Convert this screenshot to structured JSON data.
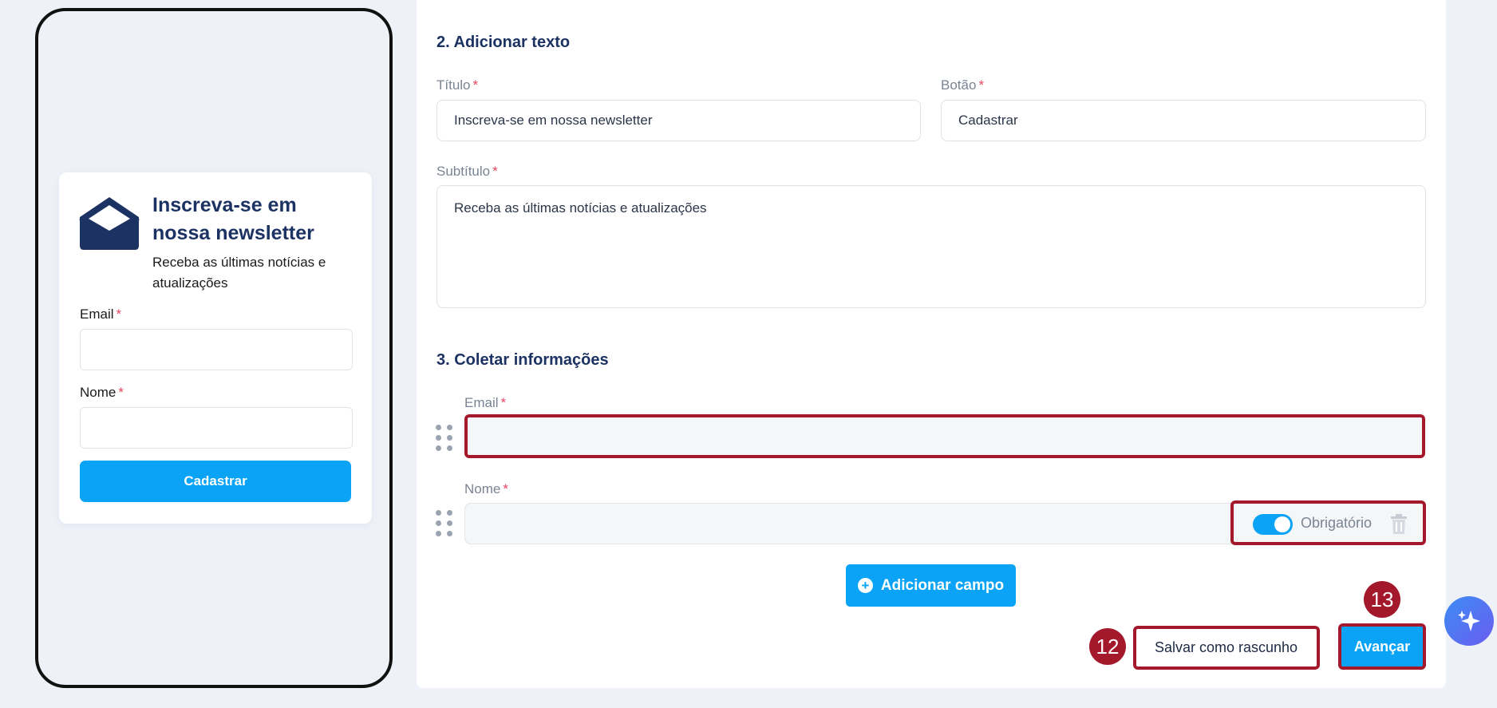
{
  "preview": {
    "title": "Inscreva-se em nossa newsletter",
    "subtitle": "Receba as últimas notícias e atualizações",
    "fields": [
      {
        "label": "Email",
        "required_mark": "*"
      },
      {
        "label": "Nome",
        "required_mark": "*"
      }
    ],
    "button_label": "Cadastrar",
    "icon": "envelope-open-icon"
  },
  "section_text": {
    "heading": "2. Adicionar texto",
    "title_label": "Título",
    "title_value": "Inscreva-se em nossa newsletter",
    "button_label": "Botão",
    "button_value": "Cadastrar",
    "subtitle_label": "Subtítulo",
    "subtitle_value": "Receba as últimas notícias e atualizações",
    "required_mark": "*"
  },
  "section_collect": {
    "heading": "3. Coletar informações",
    "fields": [
      {
        "label": "Email",
        "required_mark": "*"
      },
      {
        "label": "Nome",
        "required_mark": "*",
        "toggle_label": "Obrigatório",
        "toggle_on": true
      }
    ],
    "add_field_label": "Adicionar campo"
  },
  "footer": {
    "draft_label": "Salvar como rascunho",
    "next_label": "Avançar"
  },
  "badges": {
    "draft": "12",
    "next": "13"
  },
  "colors": {
    "accent": "#0aa3f5",
    "highlight": "#a3182a",
    "heading": "#1c3263"
  }
}
